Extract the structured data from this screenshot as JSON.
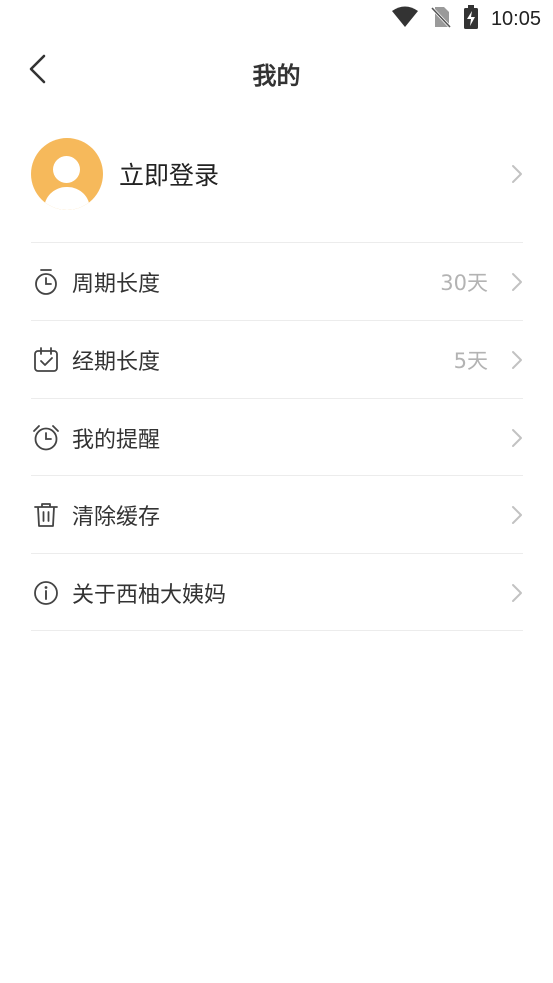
{
  "status_bar": {
    "time": "10:05",
    "icons": [
      "wifi-icon",
      "no-sim-icon",
      "battery-charging-icon"
    ]
  },
  "header": {
    "title": "我的",
    "back_icon": "chevron-left-icon"
  },
  "profile": {
    "login_label": "立即登录",
    "avatar_color": "#f6b95b"
  },
  "menu": [
    {
      "label": "周期长度",
      "value": "30天",
      "icon": "timer-icon"
    },
    {
      "label": "经期长度",
      "value": "5天",
      "icon": "calendar-check-icon"
    },
    {
      "label": "我的提醒",
      "value": "",
      "icon": "alarm-clock-icon"
    },
    {
      "label": "清除缓存",
      "value": "",
      "icon": "trash-icon"
    },
    {
      "label": "关于西柚大姨妈",
      "value": "",
      "icon": "info-icon"
    }
  ]
}
